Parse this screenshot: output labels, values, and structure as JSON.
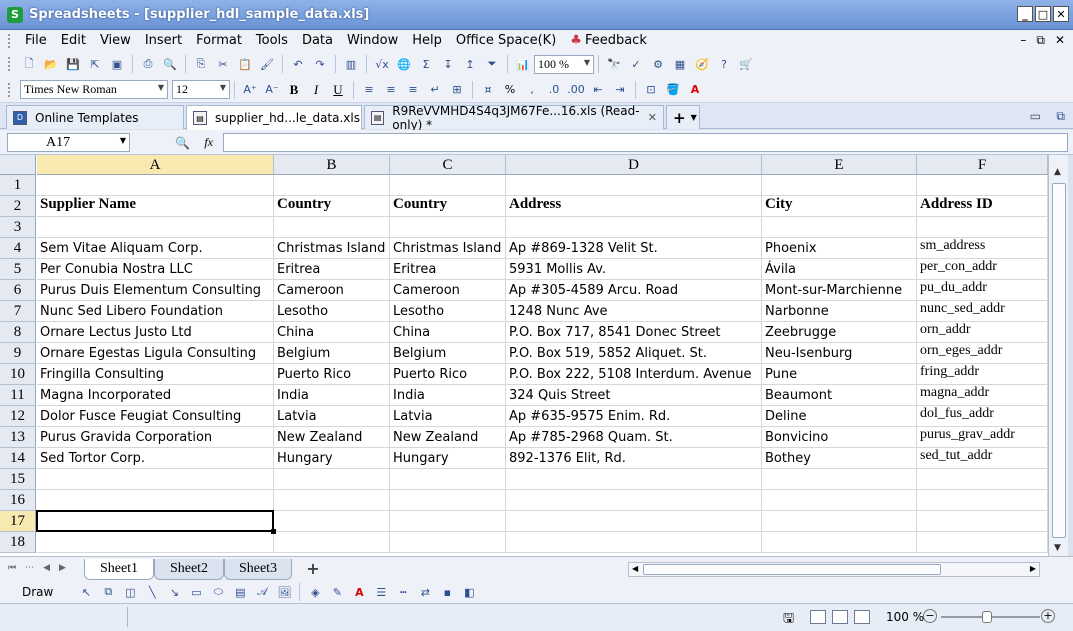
{
  "window": {
    "app_icon": "S",
    "title": "Spreadsheets - [supplier_hdl_sample_data.xls]",
    "controls": [
      "_",
      "□",
      "✕"
    ]
  },
  "menu": {
    "items": [
      "File",
      "Edit",
      "View",
      "Insert",
      "Format",
      "Tools",
      "Data",
      "Window",
      "Help",
      "Office Space(K)"
    ],
    "feedback": "Feedback",
    "mdi_controls": [
      "–",
      "⧉",
      "✕"
    ]
  },
  "toolbar": {
    "zoom": "100 %",
    "font_name": "Times New Roman",
    "font_size": "12",
    "bold": "B",
    "italic": "I",
    "underline": "U",
    "percent": "%",
    "fx": "fx"
  },
  "doc_tabs": [
    {
      "label": "Online Templates",
      "icon": "D"
    },
    {
      "label": "supplier_hd...le_data.xls",
      "icon": "▤"
    },
    {
      "label": "R9ReVVMHD4S4q3JM67Fe...16.xls (Read-only) *",
      "icon": "▤"
    }
  ],
  "formula_bar": {
    "cell_ref": "A17",
    "formula": ""
  },
  "sheet": {
    "columns": [
      "A",
      "B",
      "C",
      "D",
      "E",
      "F"
    ],
    "rows": [
      "1",
      "2",
      "3",
      "4",
      "5",
      "6",
      "7",
      "8",
      "9",
      "10",
      "11",
      "12",
      "13",
      "14",
      "15",
      "16",
      "17",
      "18"
    ],
    "headers": [
      "Supplier Name",
      "Country",
      "Country",
      "Address",
      "City",
      "Address ID"
    ],
    "data": [
      [
        "Sem Vitae Aliquam Corp.",
        "Christmas Island",
        "Christmas Island",
        "Ap #869-1328 Velit St.",
        "Phoenix",
        "sm_address"
      ],
      [
        "Per Conubia Nostra LLC",
        "Eritrea",
        "Eritrea",
        "5931 Mollis Av.",
        "Ávila",
        "per_con_addr"
      ],
      [
        "Purus Duis Elementum Consulting",
        "Cameroon",
        "Cameroon",
        "Ap #305-4589 Arcu. Road",
        "Mont-sur-Marchienne",
        "pu_du_addr"
      ],
      [
        "Nunc Sed Libero Foundation",
        "Lesotho",
        "Lesotho",
        "1248 Nunc Ave",
        "Narbonne",
        "nunc_sed_addr"
      ],
      [
        "Ornare Lectus Justo Ltd",
        "China",
        "China",
        "P.O. Box 717, 8541 Donec Street",
        "Zeebrugge",
        "orn_addr"
      ],
      [
        "Ornare Egestas Ligula Consulting",
        "Belgium",
        "Belgium",
        "P.O. Box 519, 5852 Aliquet. St.",
        "Neu-Isenburg",
        "orn_eges_addr"
      ],
      [
        "Fringilla Consulting",
        "Puerto Rico",
        "Puerto Rico",
        "P.O. Box 222, 5108 Interdum. Avenue",
        "Pune",
        "fring_addr"
      ],
      [
        "Magna Incorporated",
        "India",
        "India",
        "324 Quis Street",
        "Beaumont",
        "magna_addr"
      ],
      [
        "Dolor Fusce Feugiat Consulting",
        "Latvia",
        "Latvia",
        "Ap #635-9575 Enim. Rd.",
        "Deline",
        "dol_fus_addr"
      ],
      [
        "Purus Gravida Corporation",
        "New Zealand",
        "New Zealand",
        "Ap #785-2968 Quam. St.",
        "Bonvicino",
        "purus_grav_addr"
      ],
      [
        "Sed Tortor Corp.",
        "Hungary",
        "Hungary",
        "892-1376 Elit, Rd.",
        "Bothey",
        "sed_tut_addr"
      ]
    ]
  },
  "sheet_tabs": [
    "Sheet1",
    "Sheet2",
    "Sheet3"
  ],
  "add_sheet": "+",
  "draw": {
    "label": "Draw"
  },
  "status": {
    "zoom": "100 %",
    "zoom_minus": "−",
    "zoom_plus": "+"
  },
  "colors": {
    "selected_header": "#f7e9b0",
    "titlebar": "#6a93d6"
  }
}
